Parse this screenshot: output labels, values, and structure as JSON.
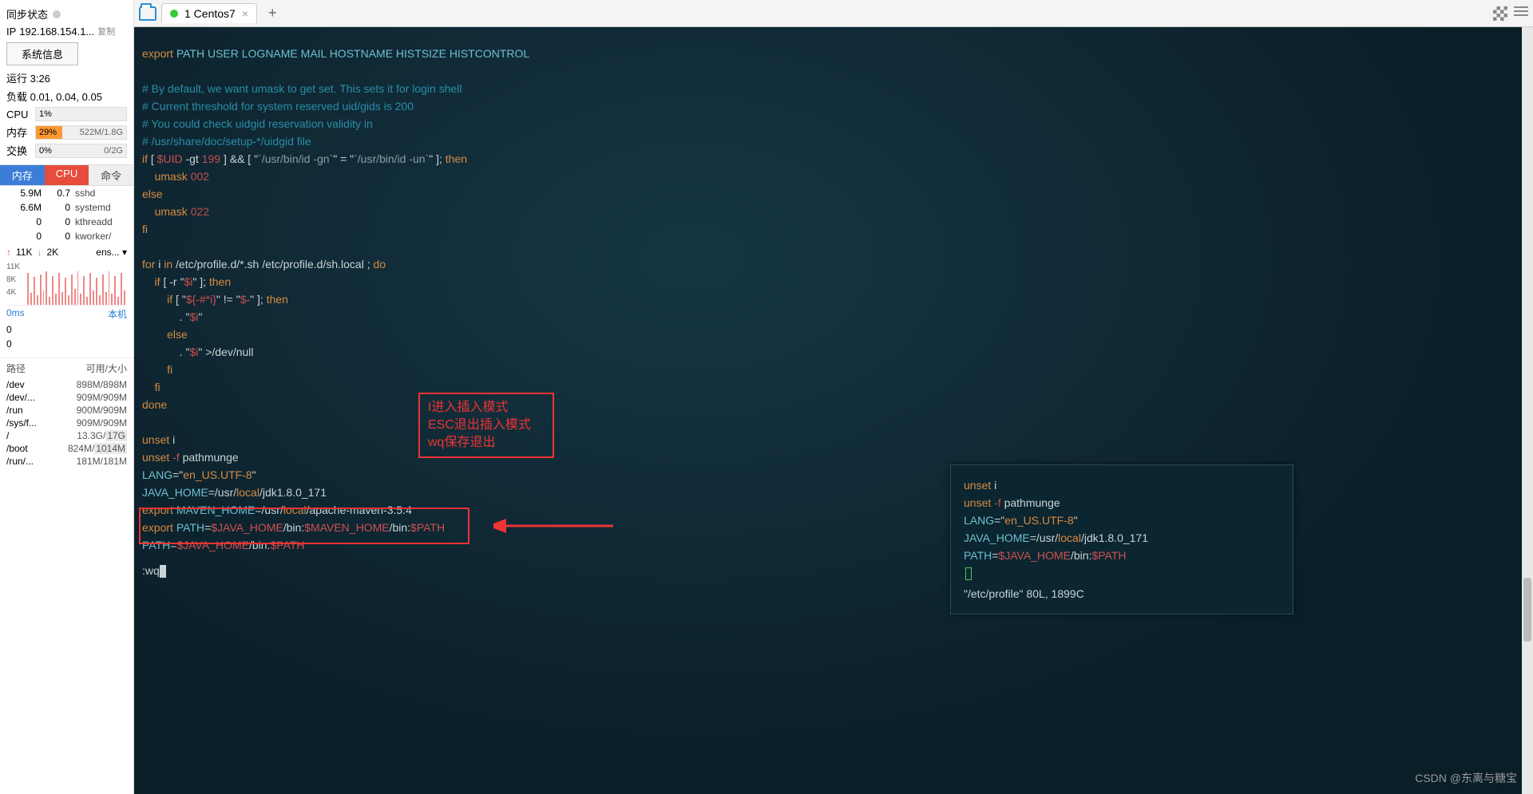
{
  "sidebar": {
    "sync_label": "同步状态",
    "ip_label": "IP",
    "ip_value": "192.168.154.1...",
    "copy_label": "复制",
    "system_info_btn": "系统信息",
    "uptime": "运行 3:26",
    "load": "负载 0.01, 0.04, 0.05",
    "cpu": {
      "label": "CPU",
      "value": "1%"
    },
    "mem": {
      "label": "内存",
      "value": "29%",
      "detail": "522M/1.8G",
      "fill": 29
    },
    "swap": {
      "label": "交换",
      "value": "0%",
      "detail": "0/2G",
      "fill": 0
    },
    "tabs": {
      "mem": "内存",
      "cpu": "CPU",
      "cmd": "命令"
    },
    "procs": [
      {
        "mem": "5.9M",
        "cpu": "0.7",
        "cmd": "sshd"
      },
      {
        "mem": "6.6M",
        "cpu": "0",
        "cmd": "systemd"
      },
      {
        "mem": "0",
        "cpu": "0",
        "cmd": "kthreadd"
      },
      {
        "mem": "0",
        "cpu": "0",
        "cmd": "kworker/"
      }
    ],
    "net": {
      "up": "11K",
      "down": "2K",
      "iface": "ens...",
      "chevron": "▾"
    },
    "chart_y": [
      "11K",
      "8K",
      "4K"
    ],
    "latency": {
      "ms": "0ms",
      "host": "本机",
      "v1": "0",
      "v2": "0"
    },
    "disk_header": {
      "path": "路径",
      "size": "可用/大小"
    },
    "disks": [
      {
        "path": "/dev",
        "size": "898M/898M"
      },
      {
        "path": "/dev/...",
        "size": "909M/909M"
      },
      {
        "path": "/run",
        "size": "900M/909M"
      },
      {
        "path": "/sys/f...",
        "size": "909M/909M"
      },
      {
        "path": "/",
        "size": "13.3G/17G",
        "hl": true
      },
      {
        "path": "/boot",
        "size": "824M/1014M",
        "hl": true
      },
      {
        "path": "/run/...",
        "size": "181M/181M"
      }
    ]
  },
  "tabbar": {
    "tab_label": "1 Centos7"
  },
  "terminal": {
    "anno_lines": [
      "I进入插入模式",
      "ESC退出插入模式",
      "wq保存退出"
    ],
    "code_lines": [
      {
        "segs": [
          [
            "kw-export",
            "export"
          ],
          [
            "kw-white",
            " "
          ],
          [
            "kw-var",
            "PATH USER LOGNAME MAIL HOSTNAME HISTSIZE HISTCONTROL"
          ]
        ]
      },
      {
        "segs": [
          [
            "",
            ""
          ]
        ]
      },
      {
        "segs": [
          [
            "kw-comment",
            "# By default, we want umask to get set. This sets it for login shell"
          ]
        ]
      },
      {
        "segs": [
          [
            "kw-comment",
            "# Current threshold for system reserved uid/gids is 200"
          ]
        ]
      },
      {
        "segs": [
          [
            "kw-comment",
            "# You could check uidgid reservation validity in"
          ]
        ]
      },
      {
        "segs": [
          [
            "kw-comment",
            "# /usr/share/doc/setup-*/uidgid file"
          ]
        ]
      },
      {
        "segs": [
          [
            "kw-ctrl",
            "if"
          ],
          [
            "kw-white",
            " [ "
          ],
          [
            "kw-envvar",
            "$UID"
          ],
          [
            "kw-white",
            " -gt "
          ],
          [
            "kw-num",
            "199"
          ],
          [
            "kw-white",
            " ] && [ \""
          ],
          [
            "kw-path",
            "`/usr/bin/id -gn`"
          ],
          [
            "kw-white",
            "\" = \""
          ],
          [
            "kw-path",
            "`/usr/bin/id -un`"
          ],
          [
            "kw-white",
            "\" ]; "
          ],
          [
            "kw-ctrl",
            "then"
          ]
        ]
      },
      {
        "segs": [
          [
            "kw-white",
            "    "
          ],
          [
            "kw-ctrl",
            "umask"
          ],
          [
            "kw-white",
            " "
          ],
          [
            "kw-num",
            "002"
          ]
        ]
      },
      {
        "segs": [
          [
            "kw-ctrl",
            "else"
          ]
        ]
      },
      {
        "segs": [
          [
            "kw-white",
            "    "
          ],
          [
            "kw-ctrl",
            "umask"
          ],
          [
            "kw-white",
            " "
          ],
          [
            "kw-num",
            "022"
          ]
        ]
      },
      {
        "segs": [
          [
            "kw-ctrl",
            "fi"
          ]
        ]
      },
      {
        "segs": [
          [
            "",
            ""
          ]
        ]
      },
      {
        "segs": [
          [
            "kw-ctrl",
            "for"
          ],
          [
            "kw-white",
            " i "
          ],
          [
            "kw-ctrl",
            "in"
          ],
          [
            "kw-white",
            " /etc/profile.d/*.sh /etc/profile.d/sh.local ; "
          ],
          [
            "kw-ctrl",
            "do"
          ]
        ]
      },
      {
        "segs": [
          [
            "kw-white",
            "    "
          ],
          [
            "kw-ctrl",
            "if"
          ],
          [
            "kw-white",
            " [ -r \""
          ],
          [
            "kw-envvar",
            "$i"
          ],
          [
            "kw-white",
            "\" ]; "
          ],
          [
            "kw-ctrl",
            "then"
          ]
        ]
      },
      {
        "segs": [
          [
            "kw-white",
            "        "
          ],
          [
            "kw-ctrl",
            "if"
          ],
          [
            "kw-white",
            " [ \""
          ],
          [
            "kw-envvar",
            "${-#*i}"
          ],
          [
            "kw-white",
            "\" != \""
          ],
          [
            "kw-envvar",
            "$-"
          ],
          [
            "kw-white",
            "\" ]; "
          ],
          [
            "kw-ctrl",
            "then"
          ]
        ]
      },
      {
        "segs": [
          [
            "kw-white",
            "            . \""
          ],
          [
            "kw-envvar",
            "$i"
          ],
          [
            "kw-white",
            "\""
          ]
        ]
      },
      {
        "segs": [
          [
            "kw-white",
            "        "
          ],
          [
            "kw-ctrl",
            "else"
          ]
        ]
      },
      {
        "segs": [
          [
            "kw-white",
            "            . \""
          ],
          [
            "kw-envvar",
            "$i"
          ],
          [
            "kw-white",
            "\" >/dev/null"
          ]
        ]
      },
      {
        "segs": [
          [
            "kw-white",
            "        "
          ],
          [
            "kw-ctrl",
            "fi"
          ]
        ]
      },
      {
        "segs": [
          [
            "kw-white",
            "    "
          ],
          [
            "kw-ctrl",
            "fi"
          ]
        ]
      },
      {
        "segs": [
          [
            "kw-ctrl",
            "done"
          ]
        ]
      },
      {
        "segs": [
          [
            "",
            ""
          ]
        ]
      },
      {
        "segs": [
          [
            "kw-ctrl",
            "unset"
          ],
          [
            "kw-white",
            " i"
          ]
        ]
      },
      {
        "segs": [
          [
            "kw-ctrl",
            "unset"
          ],
          [
            "kw-white",
            " "
          ],
          [
            "kw-flag",
            "-f"
          ],
          [
            "kw-white",
            " pathmunge"
          ]
        ]
      },
      {
        "segs": [
          [
            "kw-var",
            "LANG"
          ],
          [
            "kw-white",
            "=\""
          ],
          [
            "kw-str",
            "en_US.UTF-8"
          ],
          [
            "kw-white",
            "\""
          ]
        ]
      },
      {
        "segs": [
          [
            "kw-var",
            "JAVA_HOME"
          ],
          [
            "kw-white",
            "=/usr/"
          ],
          [
            "kw-ctrl",
            "local"
          ],
          [
            "kw-white",
            "/jdk1.8.0_171"
          ]
        ]
      },
      {
        "segs": [
          [
            "kw-export",
            "export"
          ],
          [
            "kw-white",
            " "
          ],
          [
            "kw-var",
            "MAVEN_HOME"
          ],
          [
            "kw-white",
            "=/usr/"
          ],
          [
            "kw-ctrl",
            "local"
          ],
          [
            "kw-white",
            "/apache-maven-3.5.4"
          ]
        ]
      },
      {
        "segs": [
          [
            "kw-export",
            "export"
          ],
          [
            "kw-white",
            " "
          ],
          [
            "kw-var",
            "PATH"
          ],
          [
            "kw-white",
            "="
          ],
          [
            "kw-envvar",
            "$JAVA_HOME"
          ],
          [
            "kw-white",
            "/bin:"
          ],
          [
            "kw-envvar",
            "$MAVEN_HOME"
          ],
          [
            "kw-white",
            "/bin:"
          ],
          [
            "kw-envvar",
            "$PATH"
          ]
        ]
      },
      {
        "segs": [
          [
            "kw-var",
            "PATH"
          ],
          [
            "kw-white",
            "="
          ],
          [
            "kw-envvar",
            "$JAVA_HOME"
          ],
          [
            "kw-white",
            "/bin:"
          ],
          [
            "kw-envvar",
            "$PATH"
          ]
        ]
      }
    ],
    "cmdline": ":wq",
    "inset": [
      {
        "segs": [
          [
            "kw-ctrl",
            "unset"
          ],
          [
            "kw-white",
            " i"
          ]
        ]
      },
      {
        "segs": [
          [
            "kw-ctrl",
            "unset"
          ],
          [
            "kw-white",
            " "
          ],
          [
            "kw-flag",
            "-f"
          ],
          [
            "kw-white",
            " pathmunge"
          ]
        ]
      },
      {
        "segs": [
          [
            "kw-var",
            "LANG"
          ],
          [
            "kw-white",
            "=\""
          ],
          [
            "kw-str",
            "en_US.UTF-8"
          ],
          [
            "kw-white",
            "\""
          ]
        ]
      },
      {
        "segs": [
          [
            "kw-var",
            "JAVA_HOME"
          ],
          [
            "kw-white",
            "=/usr/"
          ],
          [
            "kw-ctrl",
            "local"
          ],
          [
            "kw-white",
            "/jdk1.8.0_171"
          ]
        ]
      },
      {
        "segs": [
          [
            "kw-var",
            "PATH"
          ],
          [
            "kw-white",
            "="
          ],
          [
            "kw-envvar",
            "$JAVA_HOME"
          ],
          [
            "kw-white",
            "/bin:"
          ],
          [
            "kw-envvar",
            "$PATH"
          ]
        ]
      }
    ],
    "inset_status": "\"/etc/profile\" 80L, 1899C"
  },
  "watermark": "CSDN @东离与糖宝"
}
